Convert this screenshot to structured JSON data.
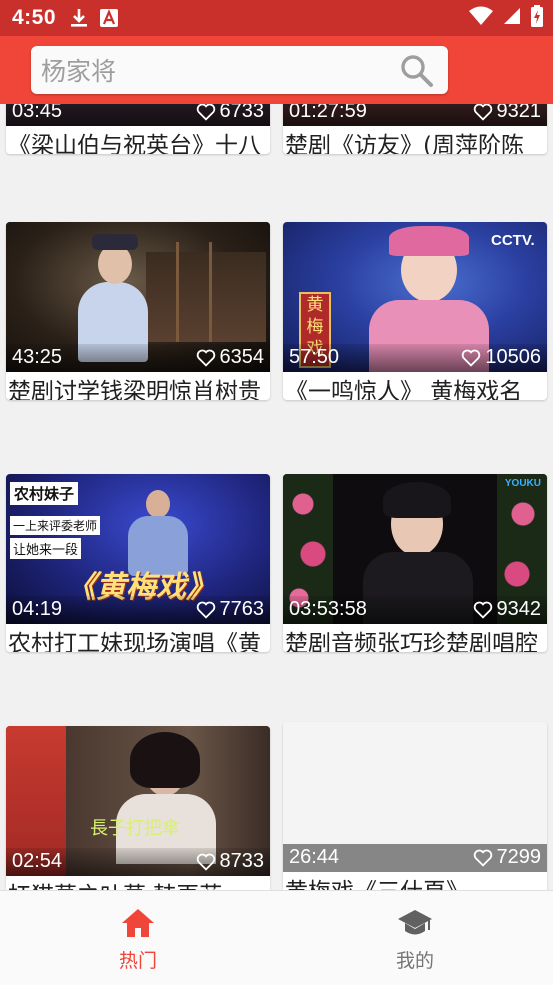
{
  "status_bar": {
    "time": "4:50"
  },
  "search": {
    "placeholder": "杨家将"
  },
  "colors": {
    "accent": "#f04539",
    "status_bar": "#c9302c",
    "nav_active": "#f04539",
    "nav_inactive": "#757575"
  },
  "videos": [
    {
      "title": "《梁山伯与祝英台》十八相送之一",
      "duration": "03:45",
      "likes": "6733"
    },
    {
      "title": "楚剧《访友》(周萍阶陈常喜)",
      "duration": "01:27:59",
      "likes": "9321"
    },
    {
      "title": "楚剧讨学钱梁明惊肖树贵主演",
      "duration": "43:25",
      "likes": "6354"
    },
    {
      "title": "《一鸣惊人》 黄梅戏名家名票组团战 吴…",
      "duration": "57:50",
      "likes": "10506"
    },
    {
      "title": "农村打工妹现场演唱《黄梅戏》，经典旋…",
      "duration": "04:19",
      "likes": "7763"
    },
    {
      "title": "楚剧音频张巧珍楚剧唱腔专辑_标清",
      "duration": "03:53:58",
      "likes": "9342"
    },
    {
      "title": "扛猫草之叶草 韩再芬",
      "duration": "02:54",
      "likes": "8733"
    },
    {
      "title": "黄梅戏《三什頁》",
      "duration": "26:44",
      "likes": "7299"
    }
  ],
  "thumb_text": {
    "cctv": "CCTV.",
    "huangmeixi_vertical": "黄梅戏",
    "banner_1": "农村妹子",
    "banner_2": "一上来评委老师",
    "banner_3": "让她来一段",
    "big_title": "《黄梅戏》",
    "youku": "YOUKU",
    "subtitle": "長子打把傘"
  },
  "bottom_nav": {
    "items": [
      {
        "label": "热门",
        "icon": "home-icon",
        "active": true
      },
      {
        "label": "我的",
        "icon": "graduation-cap-icon",
        "active": false
      }
    ]
  }
}
